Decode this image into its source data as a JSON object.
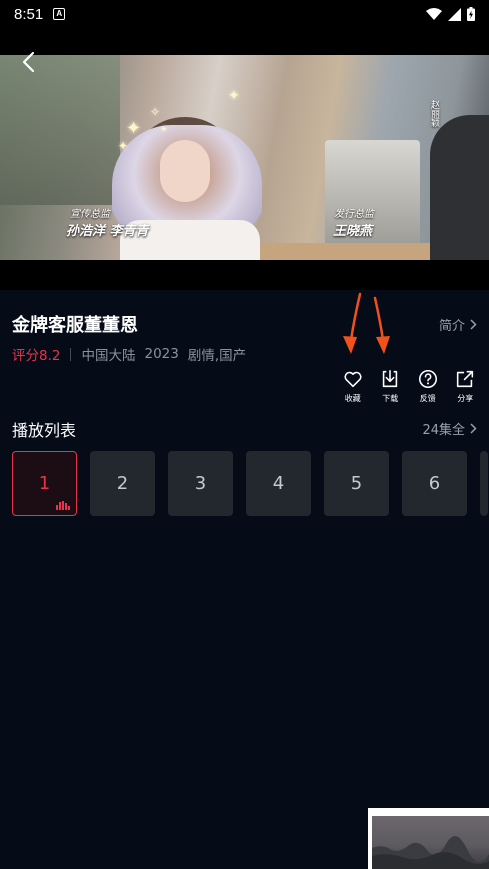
{
  "status_bar": {
    "time": "8:51",
    "notification_icon": "A"
  },
  "video": {
    "credit_left": {
      "label": "宣传总监",
      "names": "孙浩洋  李青青"
    },
    "credit_right": {
      "label": "发行总监",
      "names": "王晓燕"
    },
    "side_text": "赵丽颖"
  },
  "drama": {
    "title": "金牌客服董董恩",
    "intro_label": "简介",
    "rating": "评分8.2",
    "region": "中国大陆",
    "year": "2023",
    "genres": "剧情,国产"
  },
  "actions": [
    {
      "label": "收藏",
      "icon": "heart-icon"
    },
    {
      "label": "下载",
      "icon": "download-icon"
    },
    {
      "label": "反馈",
      "icon": "help-circle-icon"
    },
    {
      "label": "分享",
      "icon": "share-icon"
    }
  ],
  "playlist": {
    "title": "播放列表",
    "all_label": "24集全",
    "episodes": [
      "1",
      "2",
      "3",
      "4",
      "5",
      "6"
    ],
    "active_index": 0
  },
  "colors": {
    "accent": "#e8334a",
    "background": "#050c18",
    "annotation_arrow": "#f2511b"
  }
}
